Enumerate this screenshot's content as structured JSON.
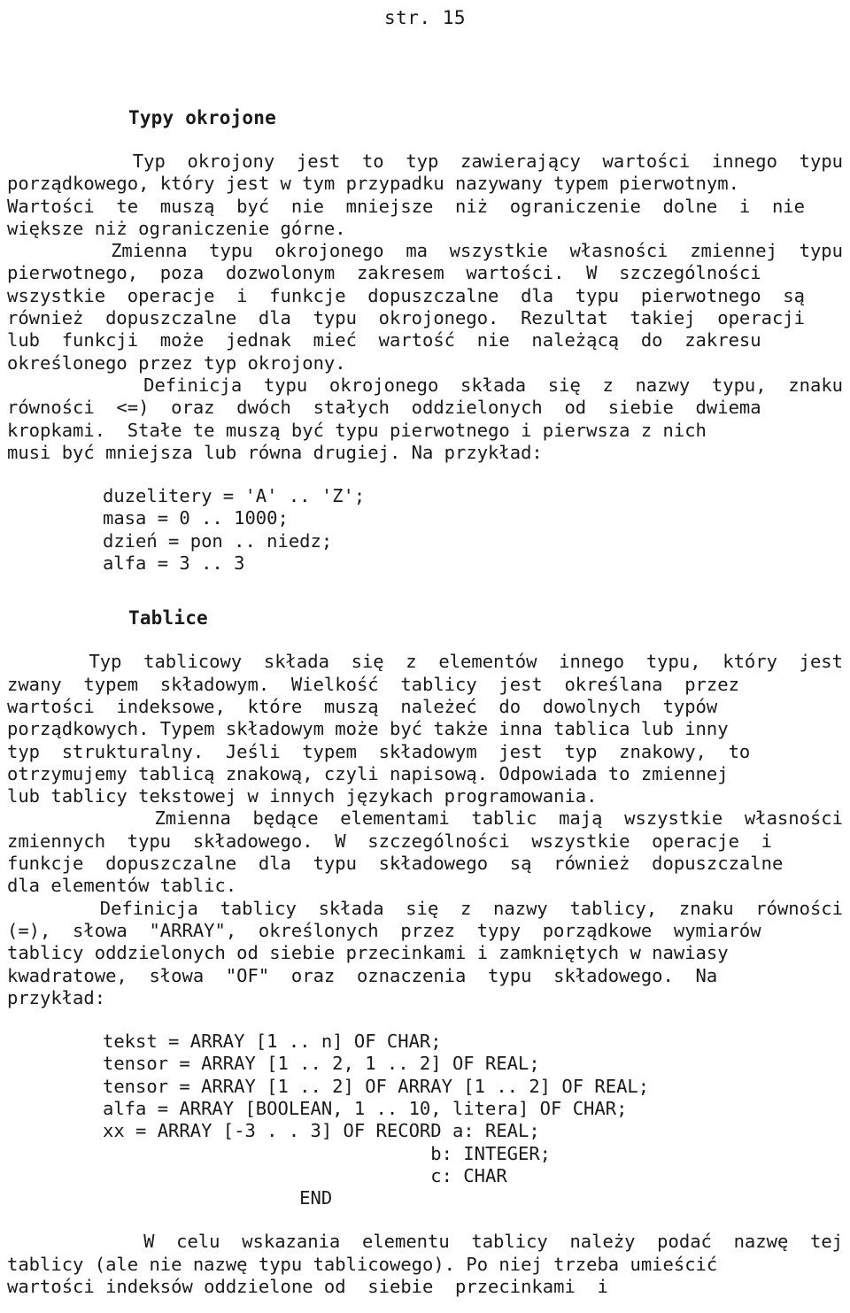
{
  "page": {
    "running_header": "str. 15"
  },
  "sections": [
    {
      "heading": "Typy okrojone",
      "paragraphs": [
        {
          "indent": true,
          "lines": [
            "Typ  okrojony  jest  to  typ  zawierający  wartości  innego  typu",
            "porządkowego, który jest w tym przypadku nazywany typem pierwotnym.",
            "Wartości  te  muszą  być  nie  mniejsze  niż  ograniczenie  dolne  i  nie",
            "większe niż ograniczenie górne."
          ]
        },
        {
          "indent": true,
          "lines": [
            "Zmienna  typu  okrojonego  ma  wszystkie  własności  zmiennej  typu",
            "pierwotnego,  poza  dozwolonym  zakresem  wartości.  W  szczególności",
            "wszystkie  operacje  i  funkcje  dopuszczalne  dla  typu  pierwotnego  są",
            "również  dopuszczalne  dla  typu  okrojonego.  Rezultat  takiej  operacji",
            "lub  funkcji  może  jednak  mieć  wartość  nie  należącą  do  zakresu",
            "określonego przez typ okrojony."
          ]
        },
        {
          "indent": true,
          "lines": [
            "Definicja  typu  okrojonego  składa  się  z  nazwy  typu,  znaku",
            "równości  <=)  oraz  dwóch  stałych  oddzielonych  od  siebie  dwiema",
            "kropkami.  Stałe te muszą być typu pierwotnego i pierwsza z nich",
            "musi być mniejsza lub równa drugiej. Na przykład:"
          ]
        }
      ],
      "example": "duzelitery = 'A' .. 'Z';\nmasa = 0 .. 1000;\ndzień = pon .. niedz;\nalfa = 3 .. 3"
    },
    {
      "heading": "Tablice",
      "paragraphs": [
        {
          "indent": true,
          "lines": [
            "Typ  tablicowy  składa  się  z  elementów  innego  typu,  który  jest",
            "zwany  typem  składowym.  Wielkość  tablicy  jest  określana  przez",
            "wartości  indeksowe,  które  muszą  należeć  do  dowolnych  typów",
            "porządkowych. Typem składowym może być także inna tablica lub inny",
            "typ  strukturalny.  Jeśli  typem  składowym  jest  typ  znakowy,  to",
            "otrzymujemy tablicą znakową, czyli napisową. Odpowiada to zmiennej",
            "lub tablicy tekstowej w innych językach programowania."
          ]
        },
        {
          "indent": true,
          "lines": [
            "Zmienna  będące  elementami  tablic  mają  wszystkie  własności",
            "zmiennych  typu  składowego.  W  szczególności  wszystkie  operacje  i",
            "funkcje  dopuszczalne  dla  typu  składowego  są  również  dopuszczalne",
            "dla elementów tablic."
          ]
        },
        {
          "indent": true,
          "lines": [
            "Definicja  tablicy  składa  się  z  nazwy  tablicy,  znaku  równości",
            "(=),  słowa  \"ARRAY\",  określonych  przez  typy  porządkowe  wymiarów",
            "tablicy oddzielonych od siebie przecinkami i zamkniętych w nawiasy",
            "kwadratowe,  słowa  \"OF\"  oraz  oznaczenia  typu  składowego.  Na",
            "przykład:"
          ]
        }
      ],
      "example": "tekst = ARRAY [1 .. n] OF CHAR;\ntensor = ARRAY [1 .. 2, 1 .. 2] OF REAL;\ntensor = ARRAY [1 .. 2] OF ARRAY [1 .. 2] OF REAL;\nalfa = ARRAY [BOOLEAN, 1 .. 10, litera] OF CHAR;\nxx = ARRAY [-3 . . 3] OF RECORD a: REAL;\n                              b: INTEGER;\n                              c: CHAR\n                  END",
      "closing_paragraph": {
        "indent": true,
        "lines": [
          "W  celu  wskazania  elementu  tablicy  należy  podać  nazwę  tej",
          "tablicy (ale nie nazwę typu tablicowego). Po niej trzeba umieścić",
          "wartości indeksów oddzielone od  siebie  przecinkami  i"
        ]
      }
    }
  ]
}
